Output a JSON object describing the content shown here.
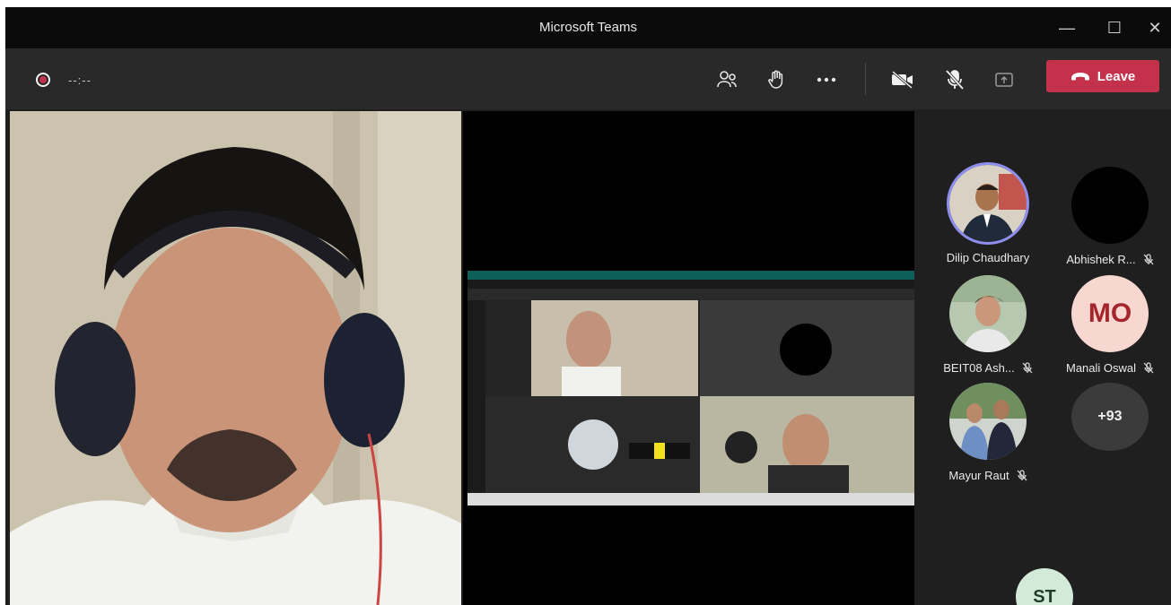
{
  "window": {
    "title": "Microsoft Teams"
  },
  "window_controls": {
    "minimize": "—",
    "maximize": "☐",
    "close": "✕"
  },
  "toolbar": {
    "timer": "--:--",
    "leave_label": "Leave",
    "icons": [
      "participants-icon",
      "raise-hand-icon",
      "more-icon",
      "camera-off-icon",
      "mic-off-icon",
      "share-icon",
      "phone-icon"
    ]
  },
  "participants": [
    {
      "name": "Dilip Chaudhary",
      "muted": false,
      "speaking": true
    },
    {
      "name": "Abhishek R...",
      "muted": true
    },
    {
      "name": "BEIT08 Ash...",
      "muted": true
    },
    {
      "name": "Manali Oswal",
      "muted": true,
      "initials": "MO"
    },
    {
      "name": "Mayur Raut",
      "muted": true
    },
    {
      "overflow": "+93"
    },
    {
      "initials": "ST"
    }
  ],
  "colors": {
    "leave": "#c4314b",
    "toolbar": "#292929",
    "titlebar": "#0b0b0b",
    "speaking_ring": "#8e8ef0",
    "mo_bg": "#f7d7cf",
    "mo_fg": "#a4262c"
  }
}
